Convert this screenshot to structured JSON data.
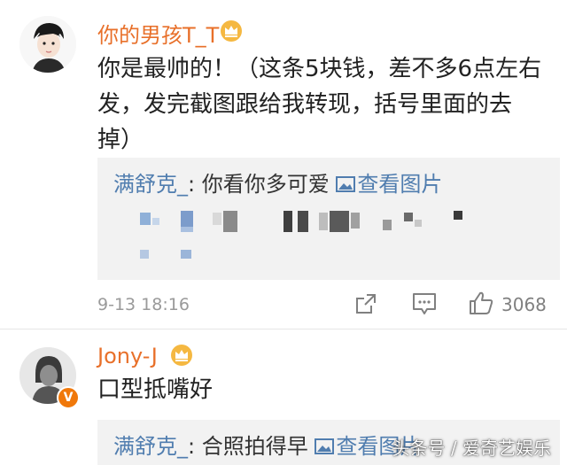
{
  "comments": [
    {
      "username": "你的男孩T_T",
      "text_lines": [
        "你是最帅的！（这条5块钱，差不多6点左右",
        "发，发完截图跟给我转现，括号里面的去",
        "掉）"
      ],
      "reply": {
        "user": "满舒克_",
        "separator": ":",
        "text": "你看你多可爱",
        "view_label": "查看图片"
      },
      "time": "9-13 18:16",
      "like_count": "3068"
    },
    {
      "username": "Jony-J",
      "text": "口型抵嘴好",
      "verified_badge": "V",
      "reply": {
        "user": "满舒克_",
        "separator": ":",
        "text": "合照拍得早",
        "view_label": "查看图片"
      }
    }
  ],
  "watermark": "头条号 / 爱奇艺娱乐",
  "colors": {
    "username": "#e8702a",
    "reply_user": "#507daf",
    "reply_bg": "#f2f2f2",
    "meta": "#9a9a9a"
  },
  "icons": [
    "crown-icon",
    "image-icon",
    "share-icon",
    "comment-icon",
    "like-icon",
    "verified-icon"
  ]
}
